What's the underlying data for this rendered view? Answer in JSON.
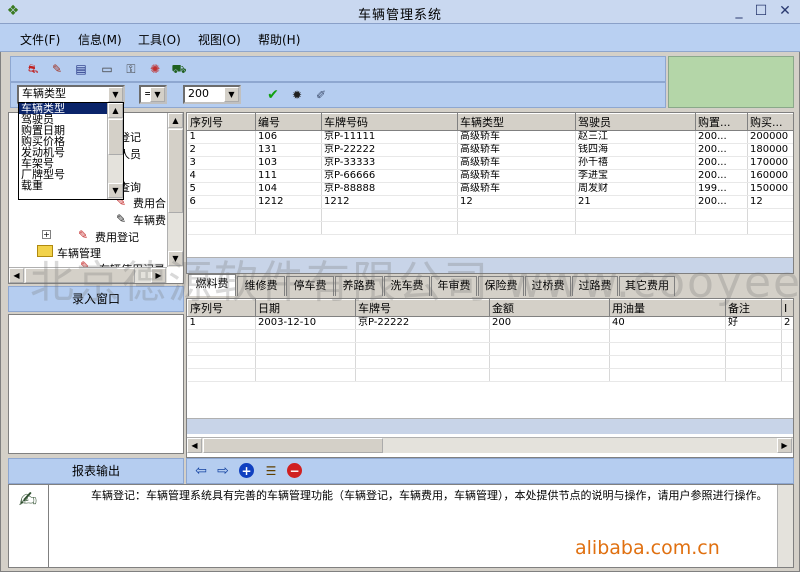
{
  "window": {
    "title": "车辆管理系统"
  },
  "menu": [
    "文件(F)",
    "信息(M)",
    "工具(O)",
    "视图(O)",
    "帮助(H)"
  ],
  "toolbar": {
    "field_combo": "车辆类型",
    "op_combo": "=",
    "value_combo": "200",
    "icons": [
      "car-icon",
      "edit-icon",
      "print-icon",
      "card-icon",
      "key-icon",
      "fire-icon",
      "truck-icon"
    ],
    "action_icons": [
      "check-icon",
      "search-bug-icon",
      "clear-icon"
    ]
  },
  "dropdown": {
    "items": [
      "车辆类型",
      "驾驶员",
      "购置日期",
      "购买价格",
      "发动机号",
      "车架号",
      "厂牌型号",
      "载重"
    ],
    "selected": 0
  },
  "tree": {
    "items": [
      "登记",
      "人员",
      "查询",
      "费用合",
      "车辆费",
      "费用登记",
      "车辆管理",
      "车辆使用记录"
    ]
  },
  "left_panels": {
    "input_window": "录入窗口",
    "report_output": "报表输出"
  },
  "top_grid": {
    "columns": [
      "序列号",
      "编号",
      "车牌号码",
      "车辆类型",
      "驾驶员",
      "购置...",
      "购买..."
    ],
    "rows": [
      [
        "1",
        "106",
        "京P-11111",
        "高级轿车",
        "赵三江",
        "200...",
        "200000"
      ],
      [
        "2",
        "131",
        "京P-22222",
        "高级轿车",
        "钱四海",
        "200...",
        "180000"
      ],
      [
        "3",
        "103",
        "京P-33333",
        "高级轿车",
        "孙千禧",
        "200...",
        "170000"
      ],
      [
        "4",
        "111",
        "京P-66666",
        "高级轿车",
        "李进宝",
        "200...",
        "160000"
      ],
      [
        "5",
        "104",
        "京P-88888",
        "高级轿车",
        "周发财",
        "199...",
        "150000"
      ],
      [
        "6",
        "1212",
        "1212",
        "12",
        "21",
        "200...",
        "12"
      ]
    ]
  },
  "tabs": [
    "燃料费",
    "维修费",
    "停车费",
    "养路费",
    "洗车费",
    "年审费",
    "保险费",
    "过桥费",
    "过路费",
    "其它费用"
  ],
  "bottom_grid": {
    "columns": [
      "序列号",
      "日期",
      "车牌号",
      "金额",
      "用油量",
      "备注",
      "I"
    ],
    "rows": [
      [
        "1",
        "2003-12-10",
        "京P-22222",
        "200",
        "40",
        "好",
        "2"
      ]
    ]
  },
  "info": {
    "text": "车辆登记：车辆管理系统具有完善的车辆管理功能（车辆登记，车辆费用，车辆管理），本处提供节点的说明与操作，请用户参照进行操作。"
  },
  "watermark": "北京德源软件有限公司 www.cooyee.com",
  "brand": "alibaba.com.cn"
}
